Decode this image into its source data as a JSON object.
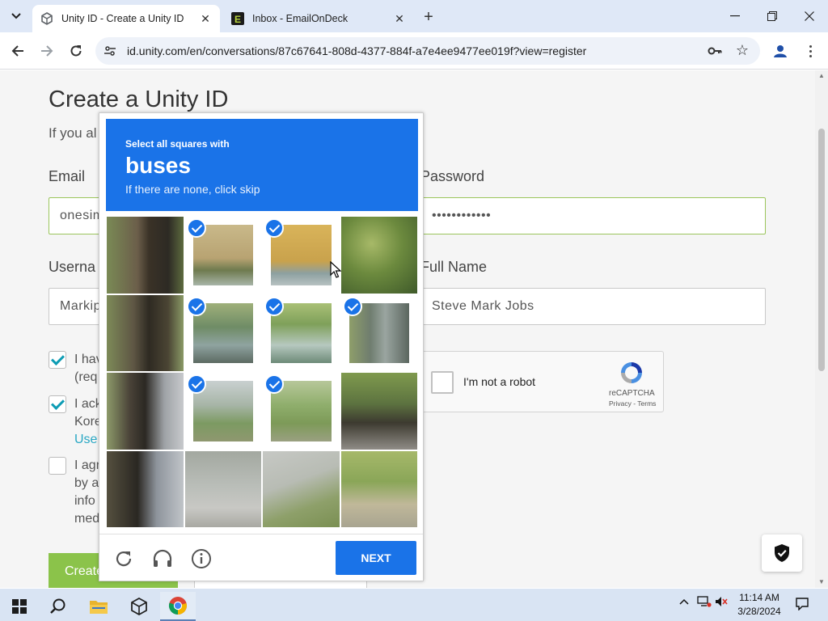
{
  "browser": {
    "tabs": [
      {
        "title": "Unity ID - Create a Unity ID",
        "active": true
      },
      {
        "title": "Inbox - EmailOnDeck",
        "active": false
      }
    ],
    "url": "id.unity.com/en/conversations/87c67641-808d-4377-884f-a7e4ee9477ee019f?view=register"
  },
  "page": {
    "title": "Create a Unity ID",
    "subtitle": "If you al",
    "email": {
      "label": "Email",
      "value": "onesim"
    },
    "password": {
      "label": "Password",
      "value": "••••••••••••"
    },
    "username": {
      "label": "Userna",
      "value": "Markip"
    },
    "fullname": {
      "label": "Full Name",
      "value": "Steve Mark Jobs"
    },
    "checkbox1": {
      "line1": "I hav",
      "line2": "(req"
    },
    "checkbox2": {
      "line1": "I ack",
      "line2": "Kore",
      "line3": "Use"
    },
    "checkbox3": {
      "line1": "I agr",
      "line2": "by a",
      "line3": "info",
      "line4": "med"
    },
    "create_button": "Create"
  },
  "recaptcha_widget": {
    "label": "I'm not a robot",
    "brand": "reCAPTCHA",
    "privacy": "Privacy",
    "sep": " - ",
    "terms": "Terms"
  },
  "challenge": {
    "instruction": "Select all squares with",
    "target": "buses",
    "hint": "If there are none, click skip",
    "next_button": "NEXT",
    "selected_tiles": [
      1,
      2,
      5,
      6,
      7,
      9,
      10
    ],
    "accent": "#1a73e8"
  },
  "taskbar": {
    "time": "11:14 AM",
    "date": "3/28/2024"
  }
}
